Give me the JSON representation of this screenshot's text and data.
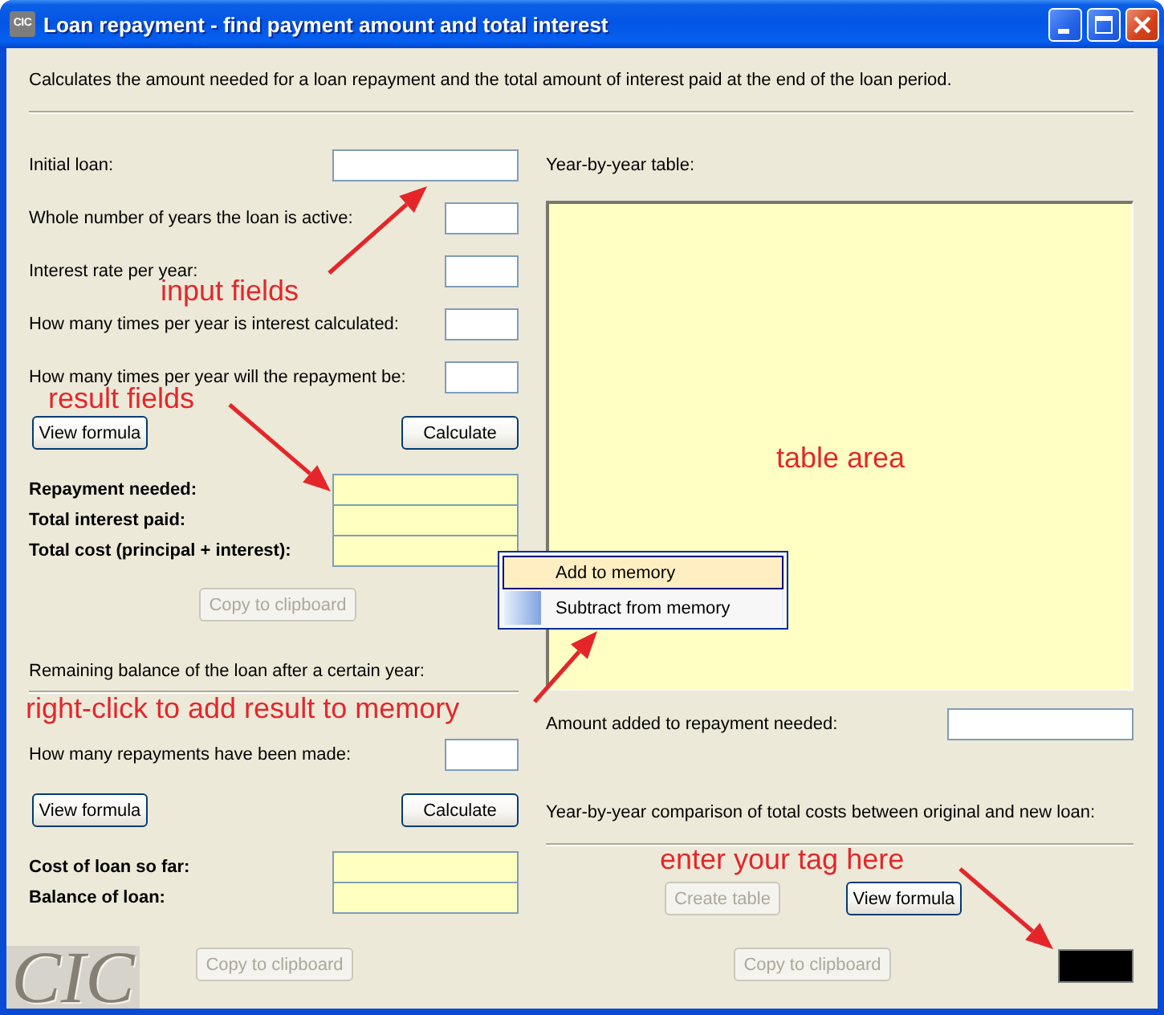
{
  "window": {
    "icon_text": "CIC",
    "title": "Loan repayment - find payment amount and total interest"
  },
  "description": "Calculates the amount needed for a loan repayment and the total amount of interest paid at the end of the loan period.",
  "repayment": {
    "inputs": [
      {
        "label": "Initial loan:",
        "kind": "wide"
      },
      {
        "label": "Whole number of years the loan is active:",
        "kind": "narrow"
      },
      {
        "label": "Interest rate per year:",
        "kind": "narrow"
      },
      {
        "label": "How many times per year is interest calculated:",
        "kind": "narrow"
      },
      {
        "label": "How many times per year will the repayment be:",
        "kind": "narrow"
      }
    ],
    "input_note": "input fields",
    "result_note": "result fields",
    "buttons": [
      {
        "label": "View formula",
        "disabled": false
      },
      {
        "label": "Calculate",
        "disabled": false
      }
    ],
    "results": [
      {
        "label": "Repayment needed:"
      },
      {
        "label": "Total interest paid:"
      },
      {
        "label": "Total cost (principal + interest):"
      }
    ],
    "copy_button": {
      "label": "Copy to clipboard",
      "disabled": true
    }
  },
  "balance": {
    "heading": "Remaining balance of the loan after a certain year:",
    "note": "right-click to add result to memory",
    "inputs": [
      {
        "label": "How many repayments have been made:",
        "kind": "narrow"
      }
    ],
    "buttons": [
      {
        "label": "View formula",
        "disabled": false
      },
      {
        "label": "Calculate",
        "disabled": false
      }
    ],
    "results": [
      {
        "label": "Cost of loan so far:"
      },
      {
        "label": "Balance of loan:"
      }
    ],
    "copy_button": {
      "label": "Copy to clipboard",
      "disabled": true
    }
  },
  "year_table": {
    "heading": "Year-by-year table:",
    "note": "table area"
  },
  "context_menu": {
    "items": [
      {
        "label": "Add to memory",
        "selected": true
      },
      {
        "label": "Subtract from memory",
        "selected": false
      }
    ]
  },
  "extra_payment": {
    "label": "Amount added to repayment needed:"
  },
  "comparison": {
    "heading": "Year-by-year comparison of total costs between original and new loan:",
    "note": "enter your tag here",
    "buttons": [
      {
        "label": "Create table",
        "disabled": true
      },
      {
        "label": "View formula",
        "disabled": false
      }
    ],
    "copy_button": {
      "label": "Copy to clipboard",
      "disabled": true
    }
  },
  "logo": {
    "text": "CIC"
  }
}
